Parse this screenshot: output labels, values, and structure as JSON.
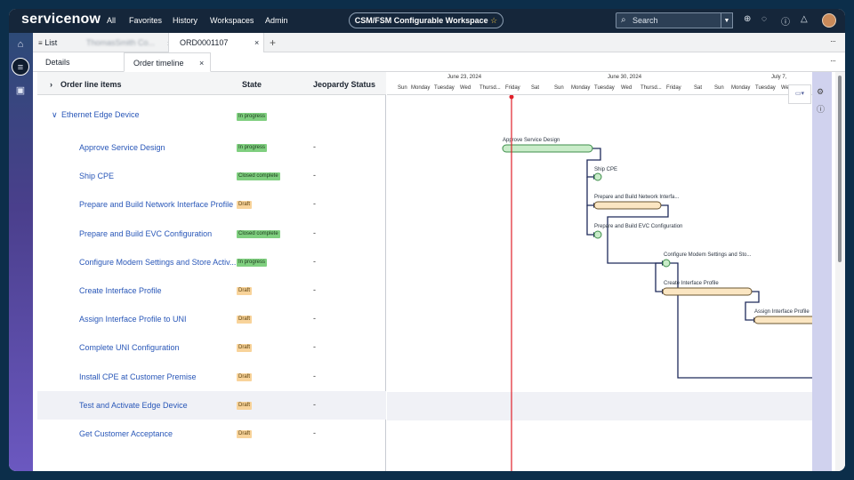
{
  "topbar": {
    "logo": "servicenow",
    "nav": [
      "All",
      "Favorites",
      "History",
      "Workspaces",
      "Admin"
    ],
    "workspace_title": "CSM/FSM Configurable Workspace",
    "search_label": "Search"
  },
  "tabs": {
    "list_label": "List",
    "blurred_label": "ThomasSmith Co...",
    "record_label": "ORD0001107"
  },
  "subtabs": {
    "details": "Details",
    "timeline": "Order timeline"
  },
  "grid": {
    "headers": {
      "name": "Order line items",
      "state": "State",
      "jeopardy": "Jeopardy Status"
    },
    "group": {
      "name": "Ethernet Edge Device",
      "state": "In progress"
    },
    "rows": [
      {
        "name": "Approve Service Design",
        "state": "In progress",
        "jeopardy": "-",
        "status": "prog"
      },
      {
        "name": "Ship CPE",
        "state": "Closed complete",
        "jeopardy": "-",
        "status": "done"
      },
      {
        "name": "Prepare and Build Network Interface Profile",
        "state": "Draft",
        "jeopardy": "-",
        "status": "draft"
      },
      {
        "name": "Prepare and Build EVC Configuration",
        "state": "Closed complete",
        "jeopardy": "-",
        "status": "done"
      },
      {
        "name": "Configure Modem Settings and Store Activ...",
        "state": "In progress",
        "jeopardy": "-",
        "status": "prog"
      },
      {
        "name": "Create Interface Profile",
        "state": "Draft",
        "jeopardy": "-",
        "status": "draft"
      },
      {
        "name": "Assign Interface Profile to UNI",
        "state": "Draft",
        "jeopardy": "-",
        "status": "draft"
      },
      {
        "name": "Complete UNI Configuration",
        "state": "Draft",
        "jeopardy": "-",
        "status": "draft"
      },
      {
        "name": "Install CPE at Customer Premise",
        "state": "Draft",
        "jeopardy": "-",
        "status": "draft"
      },
      {
        "name": "Test and Activate Edge Device",
        "state": "Draft",
        "jeopardy": "-",
        "status": "draft"
      },
      {
        "name": "Get Customer Acceptance",
        "state": "Draft",
        "jeopardy": "-",
        "status": "draft"
      }
    ]
  },
  "gantt": {
    "weeks": [
      "June 23, 2024",
      "June 30, 2024",
      "July 7,"
    ],
    "days": [
      "Sun",
      "Monday",
      "Tuesday",
      "Wed",
      "Thursd...",
      "Friday",
      "Sat",
      "Sun",
      "Monday",
      "Tuesday",
      "Wed",
      "Thursd...",
      "Friday",
      "Sat",
      "Sun",
      "Monday",
      "Tuesday",
      "We"
    ],
    "bar_labels": [
      "Approve Service Design",
      "Ship CPE",
      "Prepare and Build Network Interfa...",
      "Prepare and Build EVC Configuration",
      "Configure Modem Settings and Sto...",
      "Create Interface Profile",
      "Assign Interface Profile"
    ]
  },
  "colors": {
    "brand_dark": "#15263a",
    "link": "#2957b8",
    "progress": "#7fcf7f",
    "draft": "#f8d39a",
    "today_line": "#e0202a"
  }
}
